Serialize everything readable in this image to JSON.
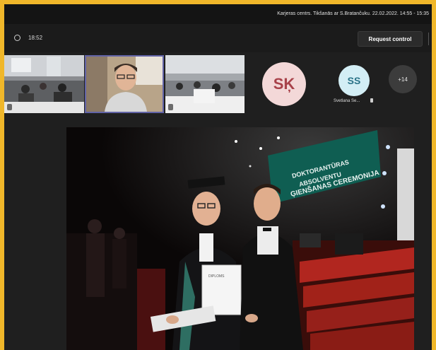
{
  "topbar": {
    "meeting_title": "Karjeras centrs. Tikšanās ar S.Bratančuku. 22.02.2022. 14:55 - 15:35"
  },
  "controls": {
    "timer": "18:52",
    "timer_icon": "shield-icon",
    "request_control": "Request control"
  },
  "participants": {
    "avatar_main_initials": "SĶ",
    "avatar_secondary_initials": "SS",
    "avatar_secondary_name": "Svetlana Se...",
    "more_count": "+14"
  },
  "shared_photo": {
    "banner_lines": [
      "DOKTORANTŪRAS",
      "ABSOLVENTU",
      "ĢIENŠANAS CEREMONIJA"
    ],
    "diploma_text": "DIPLOMS"
  },
  "colors": {
    "border_accent": "#f0b72a",
    "selected_tile": "#6264a7",
    "banner_teal": "#0f5e52",
    "stage_red": "#b1261f"
  }
}
